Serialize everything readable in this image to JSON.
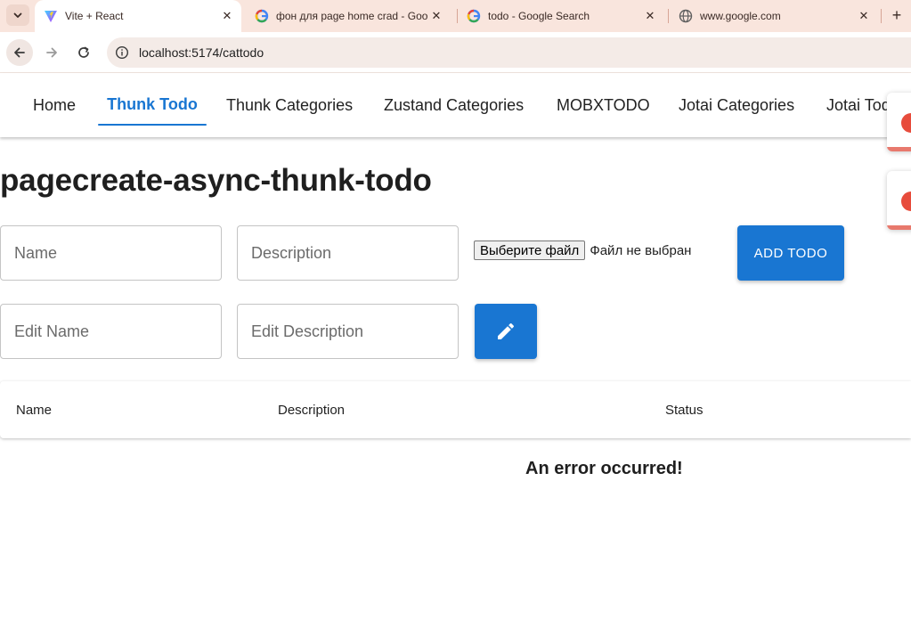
{
  "browser": {
    "tabs": [
      {
        "title": "Vite + React",
        "active": true,
        "icon": "vite-icon"
      },
      {
        "title": "фон для page home crad - Goo",
        "active": false,
        "icon": "google-icon"
      },
      {
        "title": "todo - Google Search",
        "active": false,
        "icon": "google-icon"
      },
      {
        "title": "www.google.com",
        "active": false,
        "icon": "globe-icon"
      }
    ],
    "url": "localhost:5174/cattodo"
  },
  "nav": {
    "links": [
      "Home",
      "Thunk Todo",
      "Thunk Categories",
      "Zustand Categories",
      "MOBXTODO",
      "Jotai Categories",
      "Jotai Todo"
    ],
    "active_index": 1
  },
  "page": {
    "title": "pagecreate-async-thunk-todo",
    "name_placeholder": "Name",
    "description_placeholder": "Description",
    "file_button": "Выберите файл",
    "file_status": "Файл не выбран",
    "add_button": "ADD TODO",
    "edit_name_placeholder": "Edit Name",
    "edit_description_placeholder": "Edit Description",
    "table_headers": [
      "Name",
      "Description",
      "Status"
    ],
    "error_message": "An error occurred!"
  },
  "colors": {
    "primary": "#1976d2",
    "tabstrip": "#f9e5dd",
    "toast_accent": "#e74c3c"
  }
}
